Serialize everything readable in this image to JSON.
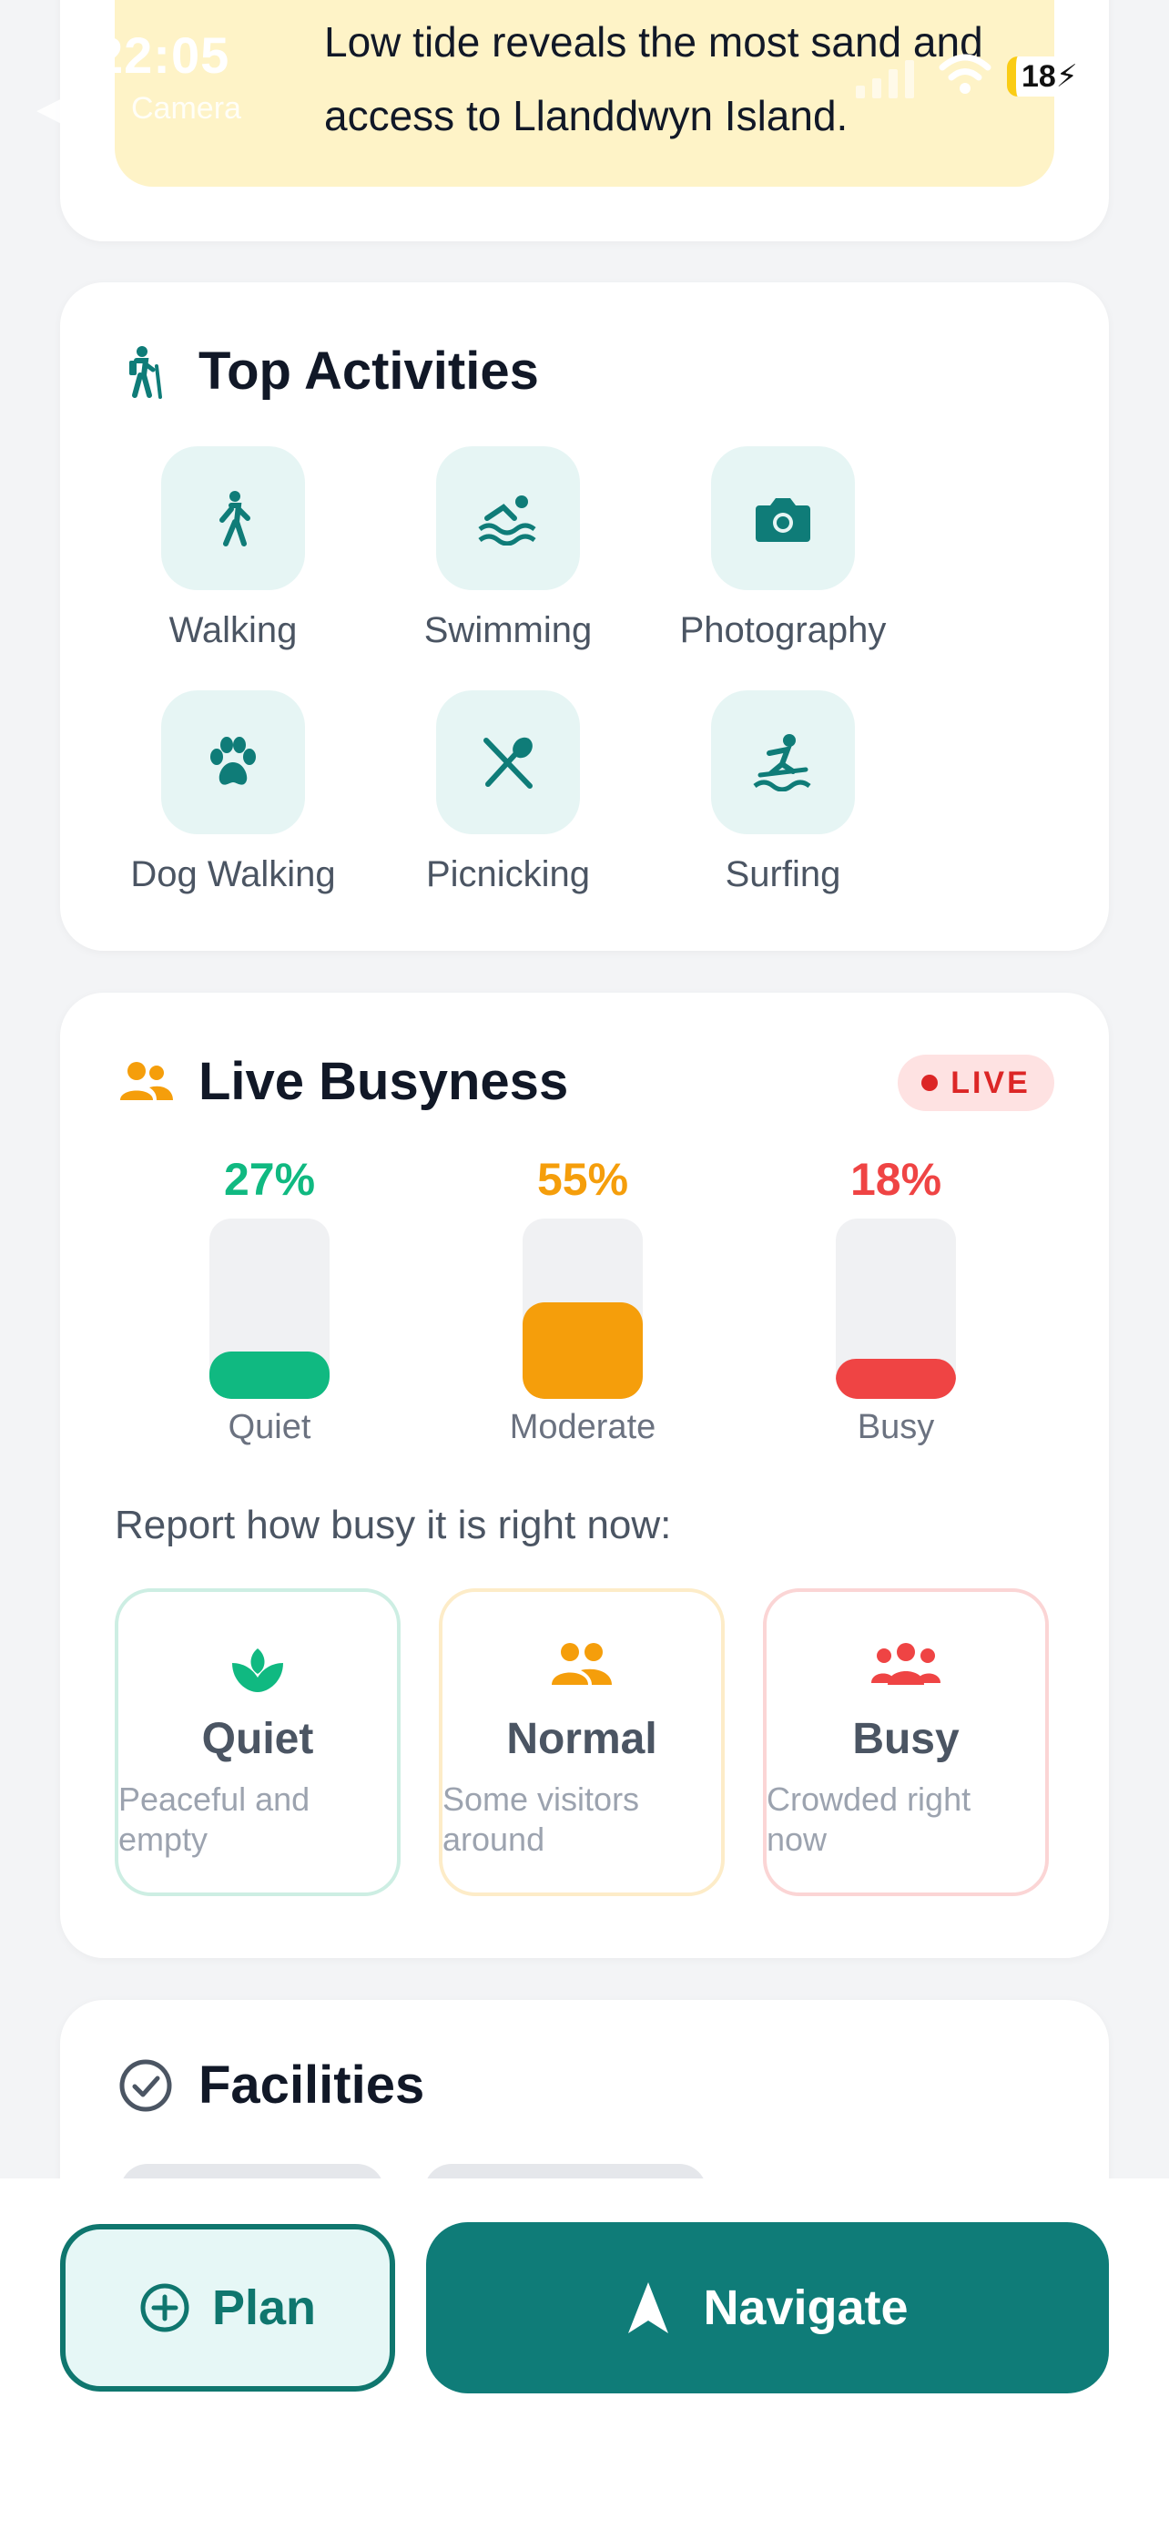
{
  "status_bar": {
    "time": "22:05",
    "back_label": "Camera",
    "battery": "18"
  },
  "tide": {
    "text": "Low tide reveals the most sand and access to Llanddwyn Island."
  },
  "activities": {
    "title": "Top Activities",
    "items": [
      {
        "label": "Walking",
        "icon": "walking-icon"
      },
      {
        "label": "Swimming",
        "icon": "swimming-icon"
      },
      {
        "label": "Photography",
        "icon": "camera-icon"
      },
      {
        "label": "Dog Walking",
        "icon": "paw-icon"
      },
      {
        "label": "Picnicking",
        "icon": "utensils-icon"
      },
      {
        "label": "Surfing",
        "icon": "surfing-icon"
      }
    ]
  },
  "busyness": {
    "title": "Live Busyness",
    "live_label": "LIVE",
    "meters": [
      {
        "label": "Quiet",
        "percent": "27%",
        "level": 0.27,
        "color": "#10b981"
      },
      {
        "label": "Moderate",
        "percent": "55%",
        "level": 0.55,
        "color": "#f59e0b"
      },
      {
        "label": "Busy",
        "percent": "18%",
        "level": 0.18,
        "color": "#ef4444"
      }
    ],
    "report_prompt": "Report how busy it is right now:",
    "report_options": [
      {
        "title": "Quiet",
        "desc": "Peaceful and empty",
        "color": "#10b981"
      },
      {
        "title": "Normal",
        "desc": "Some visitors around",
        "color": "#f59e0b"
      },
      {
        "title": "Busy",
        "desc": "Crowded right now",
        "color": "#ef4444"
      }
    ]
  },
  "facilities": {
    "title": "Facilities"
  },
  "actions": {
    "plan_label": "Plan",
    "navigate_label": "Navigate"
  },
  "colors": {
    "accent": "#0f7c78",
    "accent_light": "#e6f5f4",
    "tide_bg": "#fef3c7"
  }
}
